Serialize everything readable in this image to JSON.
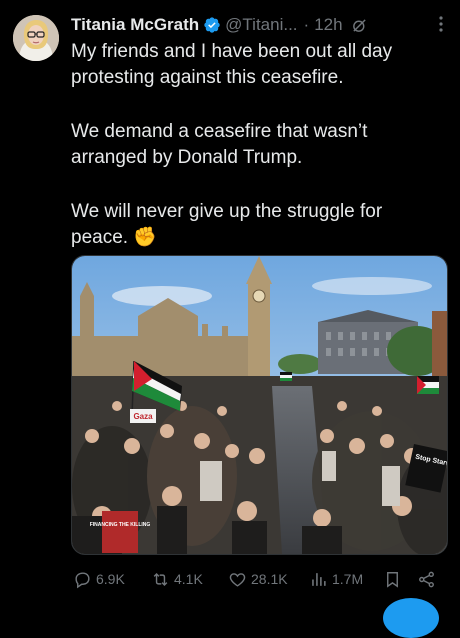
{
  "tweet": {
    "author_name": "Titania McGrath",
    "handle": "@Titani...",
    "separator": "·",
    "time": "12h",
    "paragraphs": [
      "My friends and I have been out all day protesting against this ceasefire.",
      "We demand a ceasefire that wasn’t arranged by Donald Trump.",
      "We will never give up the struggle for peace. ✊"
    ]
  },
  "media": {
    "signs": [
      "Gaza",
      "Stop Starving GAZA",
      "FINANCING THE KILLING"
    ]
  },
  "actions": {
    "replies": "6.9K",
    "reposts": "4.1K",
    "likes": "28.1K",
    "views": "1.7M"
  },
  "colors": {
    "background": "#000000",
    "text": "#e7e9ea",
    "secondary": "#71767b",
    "verified": "#1d9bf0"
  },
  "icons": [
    "verified-badge-icon",
    "grok-icon",
    "more-icon",
    "reply-icon",
    "repost-icon",
    "like-icon",
    "views-icon",
    "bookmark-icon",
    "share-icon"
  ]
}
